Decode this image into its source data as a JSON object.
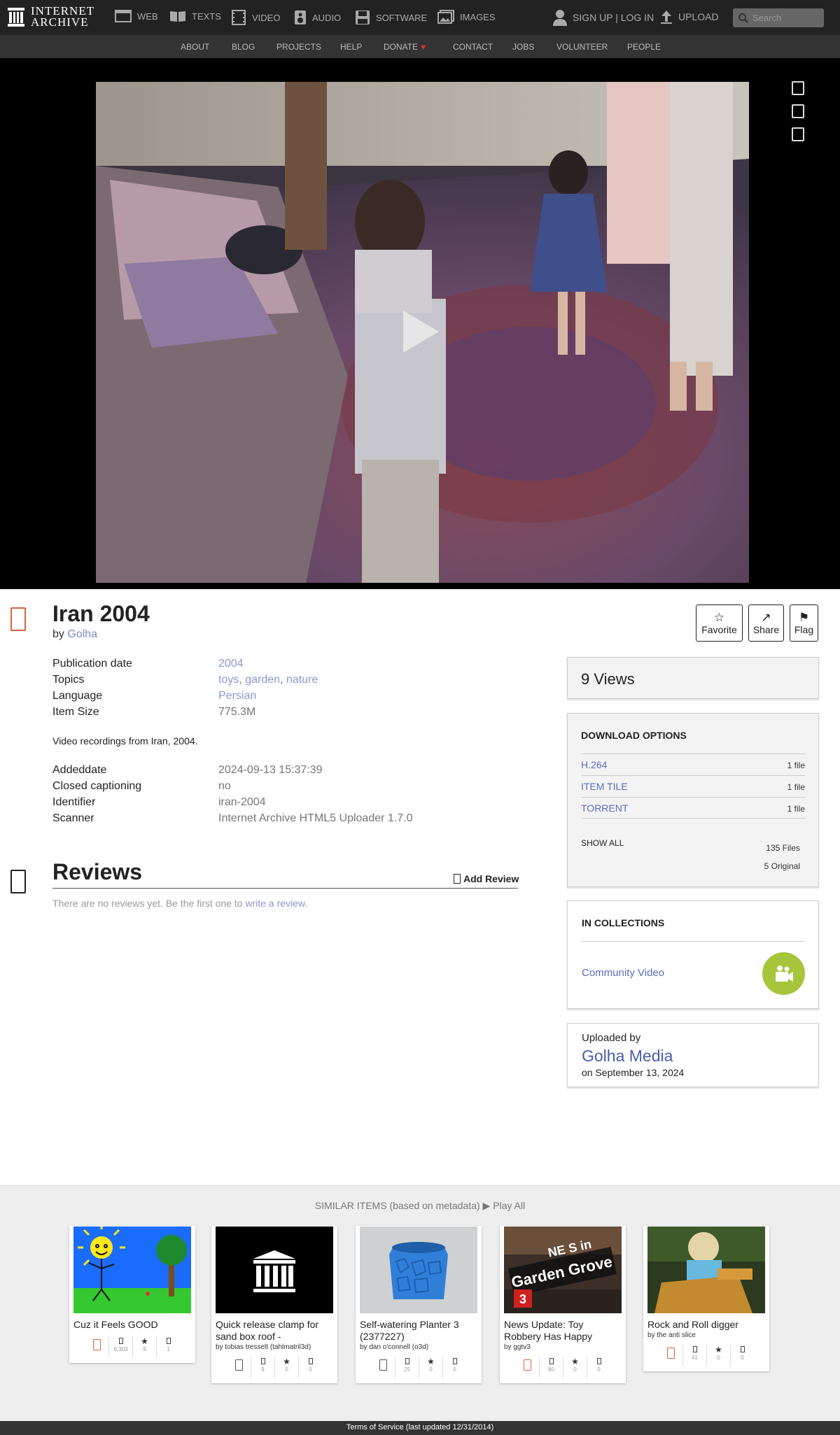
{
  "brand": {
    "line1": "INTERNET",
    "line2": "ARCHIVE"
  },
  "nav": {
    "web": "WEB",
    "texts": "TEXTS",
    "video": "VIDEO",
    "audio": "AUDIO",
    "software": "SOFTWARE",
    "images": "IMAGES",
    "signup": "SIGN UP | LOG IN",
    "upload": "UPLOAD",
    "search_placeholder": "Search"
  },
  "subnav": [
    "ABOUT",
    "BLOG",
    "PROJECTS",
    "HELP",
    "DONATE",
    "CONTACT",
    "JOBS",
    "VOLUNTEER",
    "PEOPLE"
  ],
  "item": {
    "title": "Iran 2004",
    "by_label": "by",
    "creator": "Golha",
    "actions": {
      "favorite": "Favorite",
      "share": "Share",
      "flag": "Flag"
    },
    "metadata": [
      {
        "label": "Publication date",
        "value": "2004"
      },
      {
        "label": "Topics",
        "links": [
          "toys",
          "garden",
          "nature"
        ]
      },
      {
        "label": "Language",
        "value": "Persian"
      },
      {
        "label": "Item Size",
        "value": "775.3M"
      }
    ],
    "description": "Video recordings from Iran, 2004.",
    "metadata2": [
      {
        "label": "Addeddate",
        "value": "2024-09-13 15:37:39"
      },
      {
        "label": "Closed captioning",
        "value": "no"
      },
      {
        "label": "Identifier",
        "value": "iran-2004"
      },
      {
        "label": "Scanner",
        "value": "Internet Archive HTML5 Uploader 1.7.0"
      }
    ]
  },
  "reviews": {
    "title": "Reviews",
    "add": "Add Review",
    "empty_text": "There are no reviews yet. Be the first one to",
    "empty_link": "write a review",
    "empty_end": "."
  },
  "sidebar": {
    "views": "9 Views",
    "download_head": "DOWNLOAD OPTIONS",
    "downloads": [
      {
        "format": "H.264",
        "count": "1 file"
      },
      {
        "format": "ITEM TILE",
        "count": "1 file"
      },
      {
        "format": "TORRENT",
        "count": "1 file"
      }
    ],
    "show_all": "SHOW ALL",
    "total_files": "135 Files",
    "original_files": "5 Original",
    "collections_head": "IN COLLECTIONS",
    "collection": "Community Video",
    "uploaded_by_label": "Uploaded by",
    "uploader": "Golha Media",
    "upload_date": "on September 13, 2024"
  },
  "similar": {
    "heading": "SIMILAR ITEMS (based on metadata)",
    "play_all": "Play All",
    "items": [
      {
        "name": "Cuz it Feels GOOD",
        "by": "",
        "views": "6,303",
        "favs": "9",
        "reviews": "1",
        "type": "video"
      },
      {
        "name": "Quick release clamp for sand box roof -",
        "by": "by tobias tresselt (tahlmatril3d)",
        "views": "9",
        "favs": "0",
        "reviews": "0",
        "type": "other"
      },
      {
        "name": "Self-watering Planter 3 (2377227)",
        "by": "by dan o'connell (o3d)",
        "views": "25",
        "favs": "0",
        "reviews": "0",
        "type": "other"
      },
      {
        "name": "News Update: Toy Robbery Has Happy",
        "by": "by ggtv3",
        "views": "80",
        "favs": "0",
        "reviews": "0",
        "type": "video"
      },
      {
        "name": "Rock and Roll digger",
        "by": "by the anti slice",
        "views": "41",
        "favs": "0",
        "reviews": "0",
        "type": "video"
      }
    ],
    "thumb_texts": {
      "news_top": "NE S in",
      "news_main": "Garden Grove",
      "news_num": "3"
    }
  },
  "footer": "Terms of Service (last updated 12/31/2014)",
  "colors": {
    "accent": "#5a6dbf",
    "link": "#8a97d1",
    "video_icon": "#e06040",
    "collection_badge": "#a7c53a"
  }
}
